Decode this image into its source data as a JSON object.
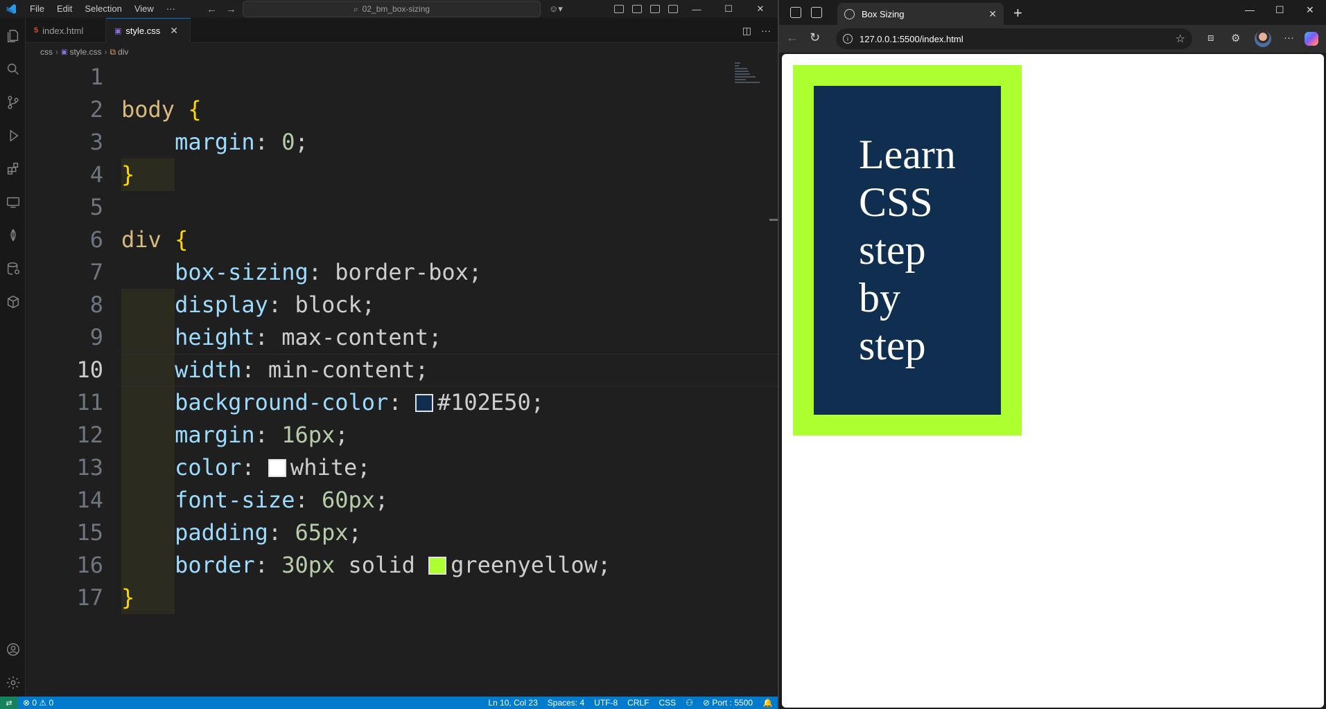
{
  "titlebar": {
    "menu": [
      "File",
      "Edit",
      "Selection",
      "View",
      "···"
    ],
    "search": "02_bm_box-sizing"
  },
  "tabs": [
    {
      "label": "index.html",
      "icon": "html-file-icon",
      "active": false
    },
    {
      "label": "style.css",
      "icon": "css-file-icon",
      "active": true
    }
  ],
  "breadcrumb": [
    "css",
    "style.css",
    "div"
  ],
  "editor": {
    "lines": [
      {
        "n": "1"
      },
      {
        "n": "2"
      },
      {
        "n": "3"
      },
      {
        "n": "4"
      },
      {
        "n": "5"
      },
      {
        "n": "6"
      },
      {
        "n": "7"
      },
      {
        "n": "8"
      },
      {
        "n": "9"
      },
      {
        "n": "10"
      },
      {
        "n": "11"
      },
      {
        "n": "12"
      },
      {
        "n": "13"
      },
      {
        "n": "14"
      },
      {
        "n": "15"
      },
      {
        "n": "16"
      },
      {
        "n": "17"
      }
    ],
    "current_line": "10",
    "code": {
      "l2_sel": "body",
      "l2_brace": "{",
      "l3_prop": "margin",
      "l3_val": "0",
      "l4_brace": "}",
      "l6_sel": "div",
      "l6_brace": "{",
      "l7_prop": "box-sizing",
      "l7_val": "border-box",
      "l8_prop": "display",
      "l8_val": "block",
      "l9_prop": "height",
      "l9_val": "max-content",
      "l10_prop": "width",
      "l10_val": "min-content",
      "l11_prop": "background-color",
      "l11_val": "#102E50",
      "l12_prop": "margin",
      "l12_val": "16px",
      "l13_prop": "color",
      "l13_val": "white",
      "l14_prop": "font-size",
      "l14_val": "60px",
      "l15_prop": "padding",
      "l15_val": "65px",
      "l16_prop": "border",
      "l16_num": "30px",
      "l16_val": "solid",
      "l16_color": "greenyellow",
      "l17_brace": "}"
    },
    "swatches": {
      "background": "#102E50",
      "color": "#ffffff",
      "border": "#adff2f"
    }
  },
  "statusbar": {
    "problems": "⊗ 0 ⚠ 0",
    "position": "Ln 10, Col 23",
    "spaces": "Spaces: 4",
    "encoding": "UTF-8",
    "eol": "CRLF",
    "language": "CSS",
    "port": "⊘ Port : 5500"
  },
  "browser": {
    "tab_title": "Box Sizing",
    "url": "127.0.0.1:5500/index.html",
    "content_lines": [
      "Learn",
      "CSS",
      "step",
      "by",
      "step"
    ],
    "box_bg": "#102E50",
    "box_border": "#adff2f"
  }
}
